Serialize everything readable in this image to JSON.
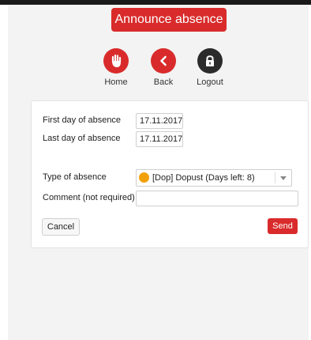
{
  "header": {
    "title": "Announce absence"
  },
  "nav": {
    "home": {
      "label": "Home",
      "icon": "hand-stop-icon",
      "color": "#d92b2b"
    },
    "back": {
      "label": "Back",
      "icon": "chevron-left-icon",
      "color": "#d92b2b"
    },
    "logout": {
      "label": "Logout",
      "icon": "lock-icon",
      "color": "#2b2b2b"
    }
  },
  "form": {
    "first_day": {
      "label": "First day of absence",
      "value": "17.11.2017"
    },
    "last_day": {
      "label": "Last day of absence",
      "value": "17.11.2017"
    },
    "type": {
      "label": "Type of absence",
      "value": "[Dop] Dopust (Days left: 8)",
      "icon": "warning-circle-icon",
      "icon_color": "#f2a10c"
    },
    "comment": {
      "label": "Comment (not required)",
      "value": "",
      "placeholder": ""
    },
    "cancel_label": "Cancel",
    "send_label": "Send"
  },
  "colors": {
    "accent": "#d92b2b",
    "dark": "#2b2b2b",
    "background": "#f3f3f3"
  }
}
